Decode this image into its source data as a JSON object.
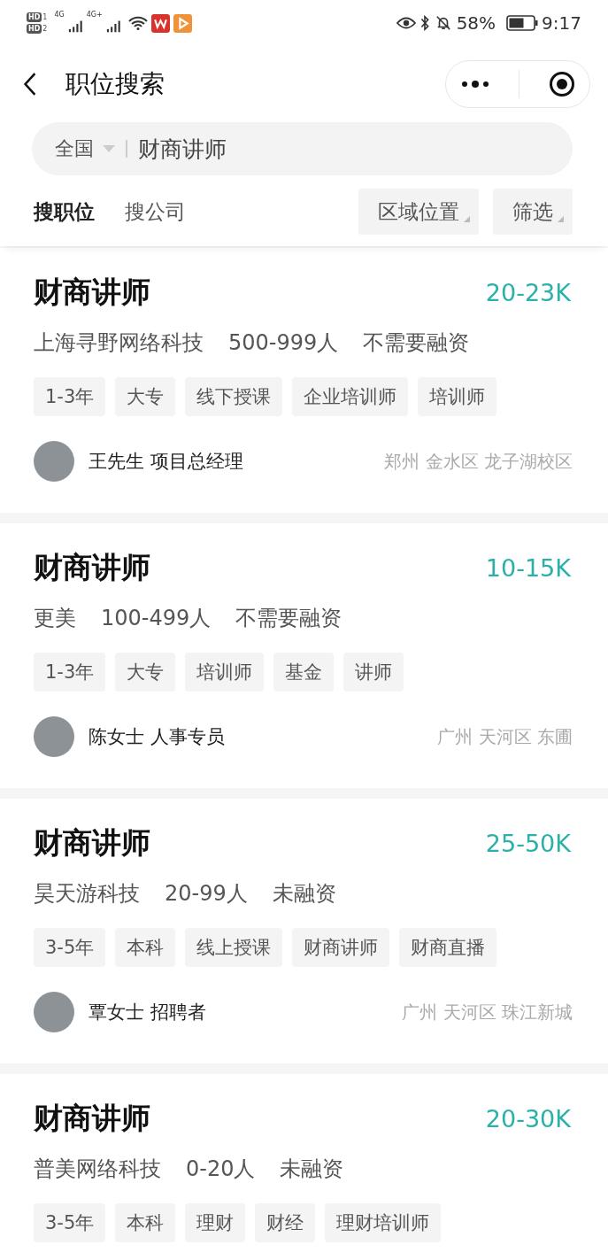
{
  "status_bar": {
    "sims": [
      {
        "label": "HD",
        "slot": "1",
        "network": "4G"
      },
      {
        "label": "HD",
        "slot": "2",
        "network": "4G+"
      }
    ],
    "battery_percent": "58%",
    "time": "9:17"
  },
  "nav": {
    "title": "职位搜索"
  },
  "search": {
    "region": "全国",
    "value": "财商讲师"
  },
  "tabs": [
    {
      "label": "搜职位",
      "selected": true
    },
    {
      "label": "搜公司",
      "selected": false
    }
  ],
  "filters": [
    "区域位置",
    "筛选"
  ],
  "jobs": [
    {
      "title": "财商讲师",
      "salary": "20-23K",
      "company": [
        "上海寻野网络科技",
        "500-999人",
        "不需要融资"
      ],
      "tags": [
        "1-3年",
        "大专",
        "线下授课",
        "企业培训师",
        "培训师"
      ],
      "recruiter": {
        "name": "王先生 项目总经理"
      },
      "location": "郑州 金水区 龙子湖校区"
    },
    {
      "title": "财商讲师",
      "salary": "10-15K",
      "company": [
        "更美",
        "100-499人",
        "不需要融资"
      ],
      "tags": [
        "1-3年",
        "大专",
        "培训师",
        "基金",
        "讲师"
      ],
      "recruiter": {
        "name": "陈女士 人事专员"
      },
      "location": "广州 天河区 东圃"
    },
    {
      "title": "财商讲师",
      "salary": "25-50K",
      "company": [
        "昊天游科技",
        "20-99人",
        "未融资"
      ],
      "tags": [
        "3-5年",
        "本科",
        "线上授课",
        "财商讲师",
        "财商直播"
      ],
      "recruiter": {
        "name": "覃女士 招聘者"
      },
      "location": "广州 天河区 珠江新城"
    },
    {
      "title": "财商讲师",
      "salary": "20-30K",
      "company": [
        "普美网络科技",
        "0-20人",
        "未融资"
      ],
      "tags": [
        "3-5年",
        "本科",
        "理财",
        "财经",
        "理财培训师"
      ]
    }
  ]
}
